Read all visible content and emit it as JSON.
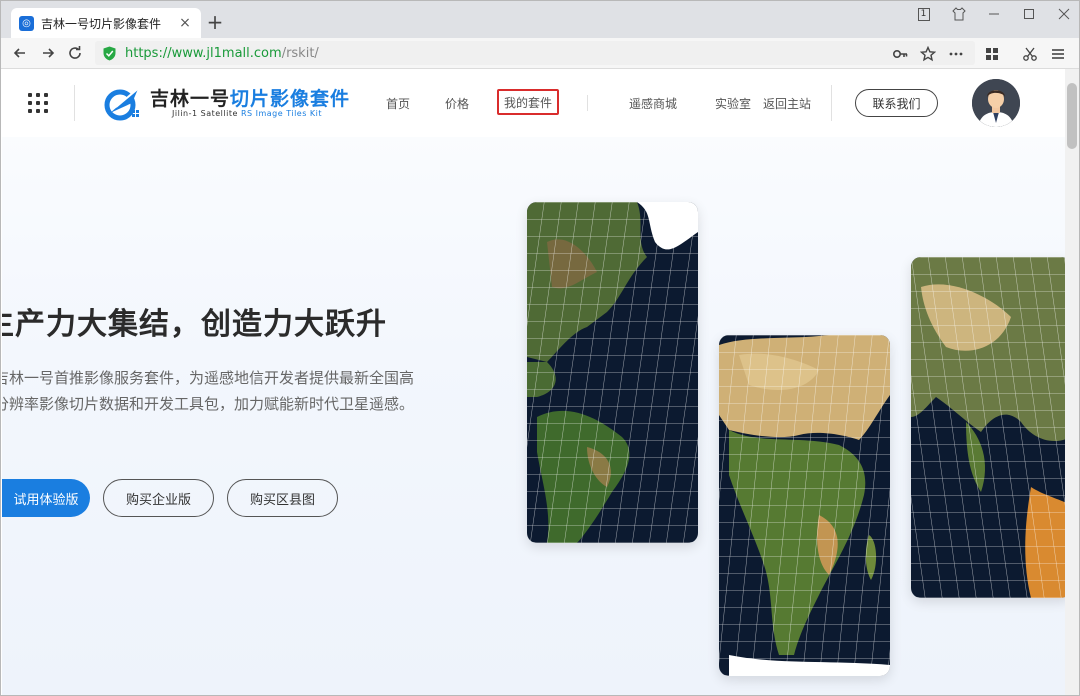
{
  "browser": {
    "tab_title": "吉林一号切片影像套件",
    "tab_close": "×",
    "new_tab": "+",
    "window_badge": "1",
    "url_host": "https://www.jl1mall.com",
    "url_path": "/rskit/"
  },
  "header": {
    "logo_title_main": "吉林一号",
    "logo_title_accent": "切片影像套件",
    "logo_sub_main": "Jilin-1  Satellite ",
    "logo_sub_accent": "RS Image Tiles Kit",
    "nav": {
      "home": "首页",
      "price": "价格",
      "my_kit": "我的套件",
      "mall": "遥感商城",
      "lab": "实验室",
      "back_main": "返回主站"
    },
    "contact": "联系我们"
  },
  "hero": {
    "title": "生产力大集结，创造力大跃升",
    "desc_line1": "吉林一号首推影像服务套件，为遥感地信开发者提供最新全国高",
    "desc_line2": "分辨率影像切片数据和开发工具包，加力赋能新时代卫星遥感。",
    "btn_trial": "试用体验版",
    "btn_enterprise": "购买企业版",
    "btn_county": "购买区县图"
  },
  "colors": {
    "accent": "#1a7ee0",
    "highlight_box": "#d92c2c",
    "url_green": "#1a9a3a"
  },
  "icons": [
    "apps-grid-icon",
    "back-arrow-icon",
    "forward-arrow-icon",
    "reload-icon",
    "shield-icon",
    "key-icon",
    "star-icon",
    "more-icon",
    "extensions-icon",
    "scissors-icon",
    "menu-icon"
  ]
}
